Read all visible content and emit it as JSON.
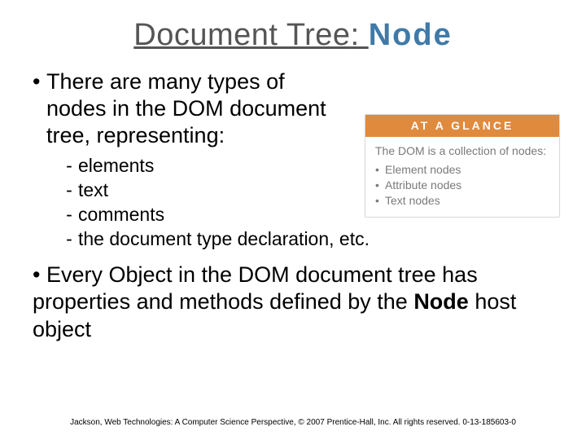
{
  "title": {
    "left": "Document Tree",
    "sep": ": ",
    "right": "Node"
  },
  "bullet1": {
    "marker": "•",
    "text": "There are many types of nodes in the DOM document tree, representing:"
  },
  "dash_items": [
    {
      "marker": "-",
      "text": "elements"
    },
    {
      "marker": "-",
      "text": "text"
    },
    {
      "marker": "-",
      "text": "comments"
    },
    {
      "marker": "-",
      "text": "the document type declaration, etc."
    }
  ],
  "bullet2": {
    "marker": "•",
    "pre": "Every Object in the DOM document tree has properties and methods defined by the ",
    "bold": "Node",
    "post": " host object"
  },
  "glance": {
    "header": "AT  A  GLANCE",
    "lead": "The DOM is a collection of nodes:",
    "items": [
      {
        "marker": "•",
        "text": "Element nodes"
      },
      {
        "marker": "•",
        "text": "Attribute nodes"
      },
      {
        "marker": "•",
        "text": "Text nodes"
      }
    ],
    "colors": {
      "header_bg": "#e08a3e"
    }
  },
  "footer": "Jackson, Web Technologies: A Computer Science Perspective, © 2007 Prentice-Hall, Inc. All rights reserved. 0-13-185603-0"
}
